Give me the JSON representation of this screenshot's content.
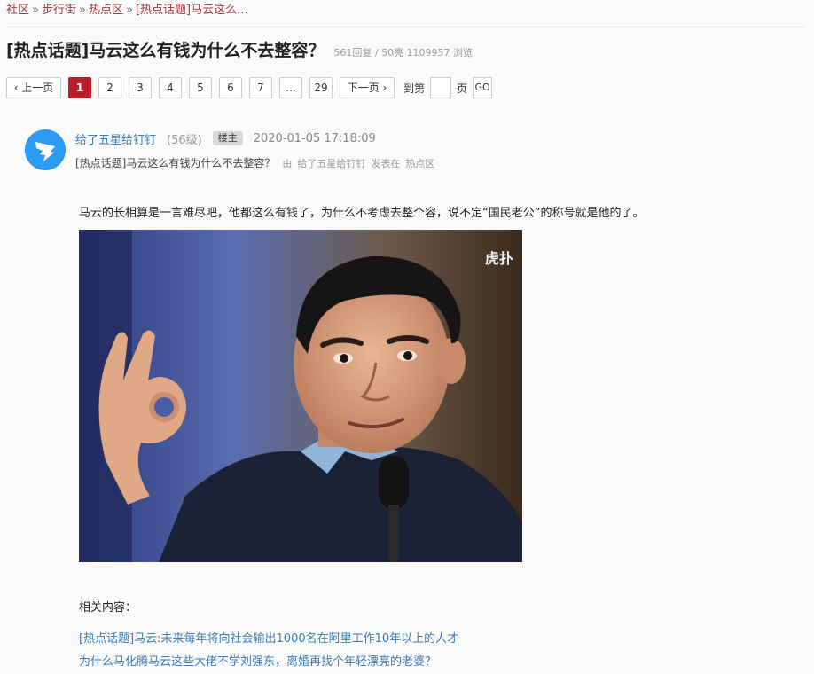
{
  "breadcrumb": {
    "items": [
      "社区",
      "步行街",
      "热点区",
      "[热点话题]马云这么..."
    ],
    "separator": "»"
  },
  "thread": {
    "title": "[热点话题]马云这么有钱为什么不去整容？",
    "stats": "561回复 / 50亮 1109957 浏览"
  },
  "pager": {
    "prev": "‹ 上一页",
    "pages": [
      "1",
      "2",
      "3",
      "4",
      "5",
      "6",
      "7",
      "...",
      "29"
    ],
    "active_page": "1",
    "next": "下一页 ›",
    "goto_label": "到第",
    "goto_value": "",
    "page_unit": "页",
    "go": "GO"
  },
  "post": {
    "author": "给了五星给钉钉",
    "level": "(56级)",
    "op_badge": "楼主",
    "time": "2020-01-05 17:18:09",
    "topic": "[热点话题]马云这么有钱为什么不去整容？",
    "by": "由",
    "by_author": "给了五星给钉钉",
    "posted_in": "发表在",
    "board": "热点区",
    "body": "马云的长相算是一言难尽吧，他都这么有钱了，为什么不考虑去整个容，说不定“国民老公”的称号就是他的了。",
    "photo_watermark": "虎扑"
  },
  "related": {
    "label": "相关内容：",
    "links": [
      "[热点话题]马云:未来每年将向社会输出1000名在阿里工作10年以上的人才",
      "为什么马化腾马云这些大佬不学刘强东，离婚再找个年轻漂亮的老婆？"
    ]
  },
  "colors": {
    "active_page": "#bb1c2a",
    "link": "#3b7bb8",
    "breadcrumb_link": "#a63a3a",
    "avatar": "#2b9cf2"
  },
  "icons": {
    "avatar": "dingtalk-logo-icon"
  }
}
